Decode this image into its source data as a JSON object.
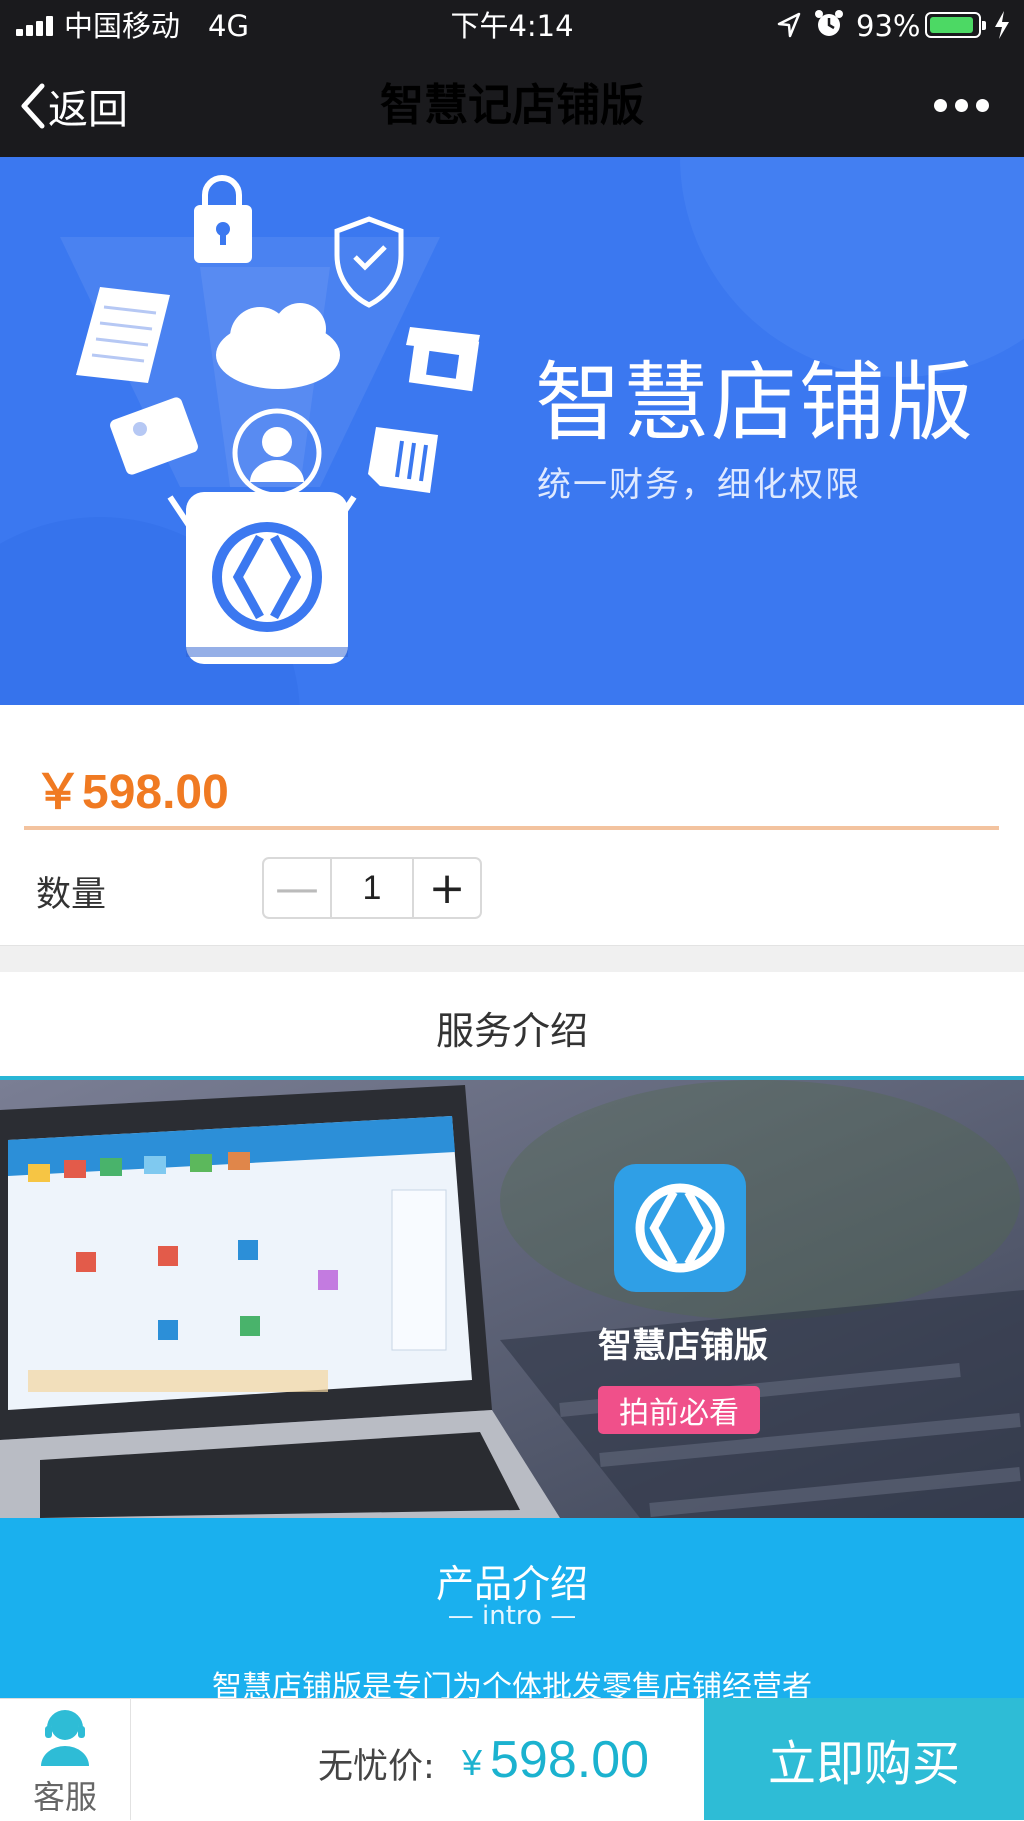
{
  "status_bar": {
    "carrier": "中国移动",
    "network": "4G",
    "time": "下午4:14",
    "battery": "93%",
    "battery_level": 0.93,
    "battery_color": "#4cd964"
  },
  "nav": {
    "back_label": "返回",
    "title": "智慧记店铺版"
  },
  "banner": {
    "title": "智慧店铺版",
    "subtitle": "统一财务，细化权限",
    "bg_color": "#3b78f0"
  },
  "product": {
    "price": "￥598.00",
    "price_color": "#f07a22",
    "quantity_label": "数量",
    "quantity_value": "1",
    "minus_symbol": "—",
    "plus_symbol": "+"
  },
  "service": {
    "section_title": "服务介绍",
    "promo_title": "智慧店铺版",
    "promo_tag": "拍前必看"
  },
  "intro": {
    "title": "产品介绍",
    "subtitle": "— intro —",
    "text": "智慧店铺版是专门为个体批发零售店铺经营者"
  },
  "bottom_bar": {
    "service_label": "客服",
    "price_label": "无忧价:",
    "currency": "¥",
    "price_value": "598.00",
    "buy_label": "立即购买",
    "accent_color": "#2ebcd6"
  }
}
